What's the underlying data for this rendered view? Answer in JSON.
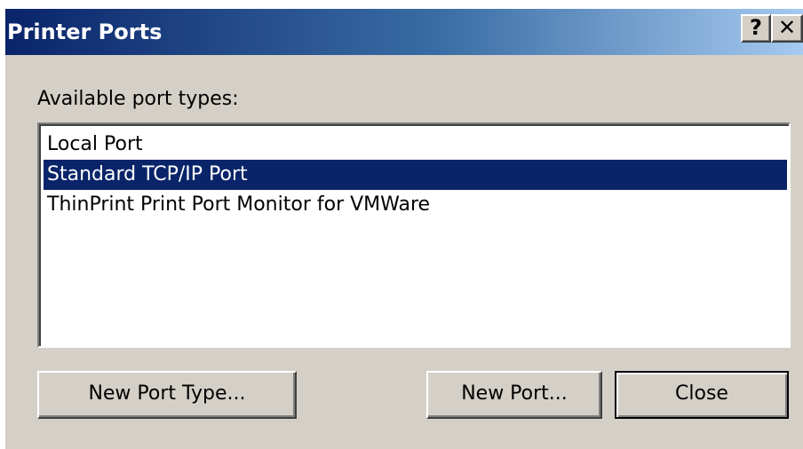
{
  "window": {
    "title": "Printer Ports",
    "help_label": "?",
    "close_label": "✕"
  },
  "main": {
    "list_label": "Available port types:",
    "port_types": [
      {
        "label": "Local Port",
        "selected": false
      },
      {
        "label": "Standard TCP/IP Port",
        "selected": true
      },
      {
        "label": "ThinPrint Print Port Monitor for VMWare",
        "selected": false
      }
    ]
  },
  "buttons": {
    "new_port_type": "New Port Type...",
    "new_port": "New Port...",
    "close": "Close"
  },
  "colors": {
    "selection": "#0a246a",
    "dialog_face": "#d4d0c8"
  }
}
